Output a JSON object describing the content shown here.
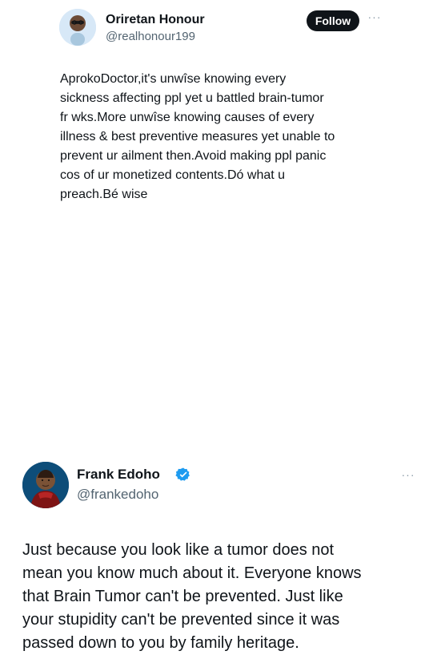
{
  "first_tweet": {
    "display_name": "Oriretan Honour",
    "handle": "@realhonour199",
    "follow_label": "Follow",
    "more_label": "···",
    "text": "AprokoDoctor,it's unwîse knowing every\nsickness affecting ppl yet u battled brain-tumor\nfr wks.More unwîse knowing causes of every\nillness & best preventive measures yet unable to\nprevent ur ailment then.Avoid making ppl panic\ncos of ur monetized contents.Dó what u\npreach.Bé wise",
    "avatar_icon": "profile-photo-man-glasses"
  },
  "second_tweet": {
    "display_name": "Frank Edoho",
    "handle": "@frankedoho",
    "more_label": "···",
    "text": "Just because you look like a tumor does not\nmean you know much about it. Everyone knows\nthat Brain Tumor can't be prevented. Just like\nyour stupidity can't be prevented since it was\npassed down to you by family heritage.",
    "avatar_icon": "profile-photo-man-red-shirt",
    "verified_icon": "verified-badge-icon"
  },
  "colors": {
    "text": "#0f1419",
    "secondary_text": "#536471",
    "follow_button": "#0f1419",
    "verified": "#1d9bf0",
    "avatar_bg_1": "#cfe3f4",
    "avatar_bg_2": "#0d4d79"
  }
}
